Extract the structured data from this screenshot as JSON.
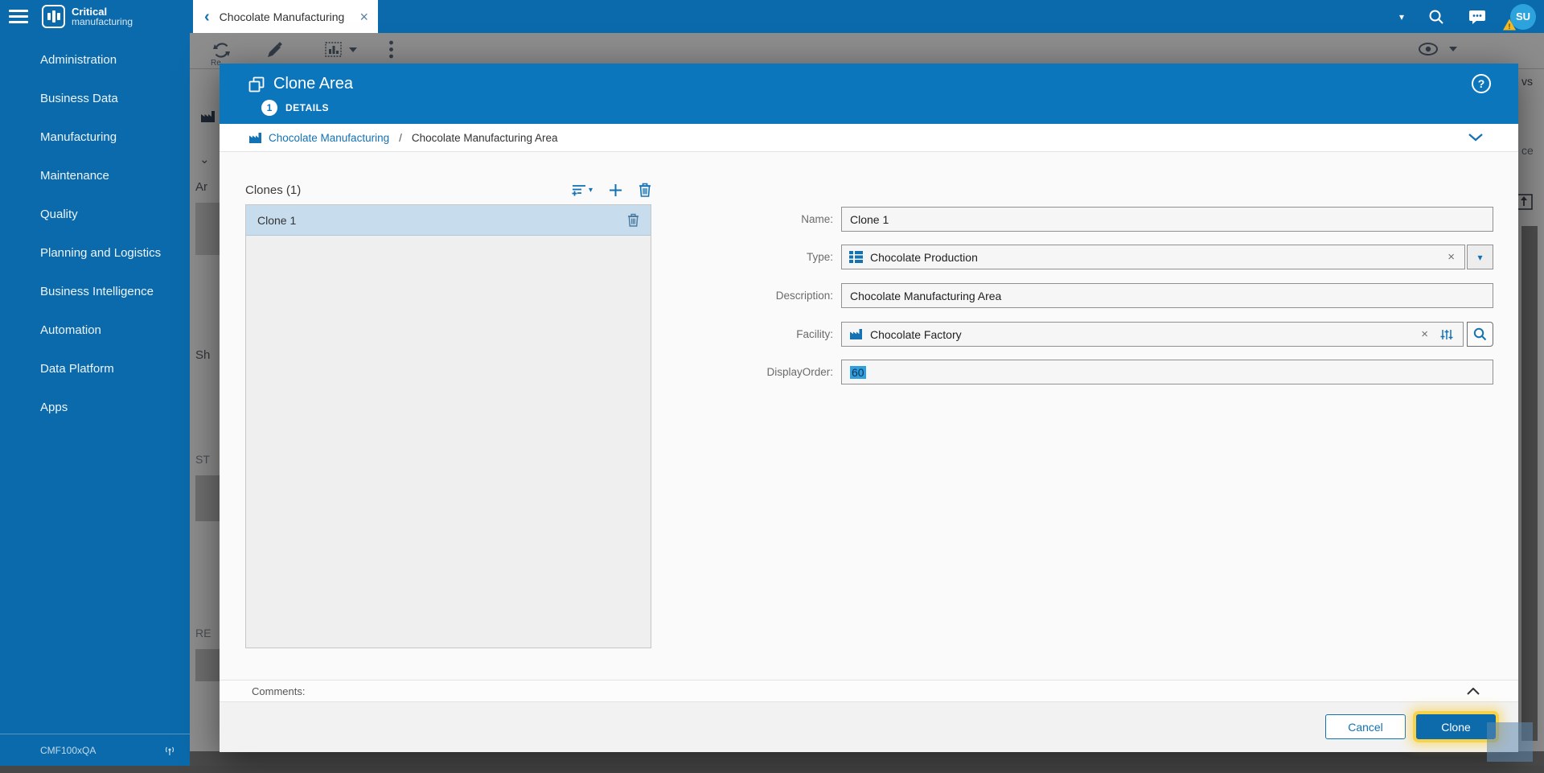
{
  "topbar": {
    "logo_line1": "Critical",
    "logo_line2": "manufacturing",
    "tab_title": "Chocolate Manufacturing",
    "back_glyph": "‹",
    "close_glyph": "×",
    "caret_glyph": "▾",
    "avatar_initials": "SU",
    "warning_glyph": "!"
  },
  "sidebar": {
    "items": [
      {
        "label": "Administration"
      },
      {
        "label": "Business Data"
      },
      {
        "label": "Manufacturing"
      },
      {
        "label": "Maintenance"
      },
      {
        "label": "Quality"
      },
      {
        "label": "Planning and Logistics"
      },
      {
        "label": "Business Intelligence"
      },
      {
        "label": "Automation"
      },
      {
        "label": "Data Platform"
      },
      {
        "label": "Apps"
      }
    ],
    "footer": {
      "environment": "CMF100xQA"
    }
  },
  "background": {
    "refresh_label": "Re",
    "fragments": {
      "f1": "Ar",
      "f2": "Sh",
      "f3": "ST",
      "f4": "RE",
      "right1": "vs",
      "right2": "ce"
    }
  },
  "modal": {
    "title": "Clone Area",
    "step": {
      "number": "1",
      "label": "DETAILS"
    },
    "breadcrumb": {
      "parent": "Chocolate Manufacturing",
      "separator": "/",
      "current": "Chocolate Manufacturing Area"
    },
    "clones": {
      "header": "Clones (1)",
      "items": [
        {
          "name": "Clone 1"
        }
      ]
    },
    "form": {
      "name": {
        "label": "Name:",
        "value": "Clone 1"
      },
      "type": {
        "label": "Type:",
        "value": "Chocolate Production"
      },
      "description": {
        "label": "Description:",
        "value": "Chocolate Manufacturing Area"
      },
      "facility": {
        "label": "Facility:",
        "value": "Chocolate Factory"
      },
      "display_order": {
        "label": "DisplayOrder:",
        "value": "60"
      }
    },
    "comments_label": "Comments:",
    "buttons": {
      "cancel": "Cancel",
      "clone": "Clone"
    }
  },
  "colors": {
    "accent": "#1272b4",
    "topbar_blue": "#0b6aab",
    "modal_header_blue": "#0c76bd",
    "selected_row": "#c7dded",
    "selection_highlight": "#2f9fe0",
    "focus_ring_yellow": "#f7d34b",
    "avatar_blue": "#2da3dd",
    "warning_yellow": "#f2b924"
  }
}
